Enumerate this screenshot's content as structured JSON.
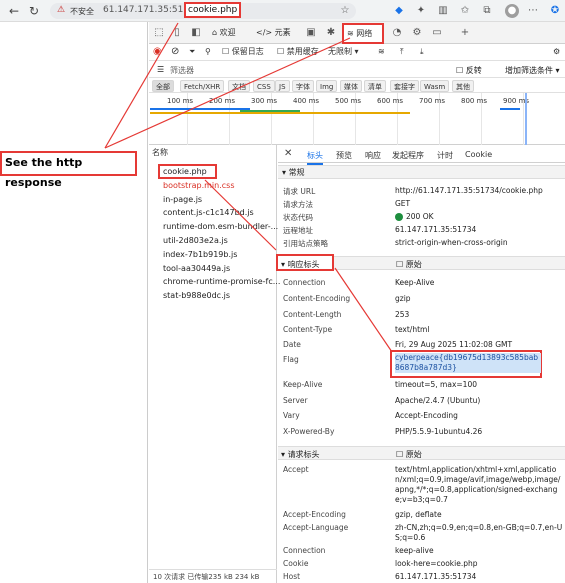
{
  "browser": {
    "security_label": "不安全",
    "url_host": "61.147.171.35:51734/",
    "url_path": "cookie.php"
  },
  "annotation": {
    "text": "See the http response"
  },
  "devtools": {
    "tabs": [
      "欢迎",
      "元素",
      "网络"
    ],
    "network_tab": "网络",
    "toolbar": {
      "preserve_log": "保留日志",
      "disable_cache": "禁用缓存",
      "throttle": "无限制"
    },
    "filter": {
      "placeholder": "筛选器",
      "invert": "反转",
      "more": "增加筛选条件"
    },
    "types": [
      "全部",
      "Fetch/XHR",
      "文档",
      "CSS",
      "JS",
      "字体",
      "Img",
      "媒体",
      "清单",
      "套接字",
      "Wasm",
      "其他"
    ],
    "timeline_ticks": [
      "100 ms",
      "200 ms",
      "300 ms",
      "400 ms",
      "500 ms",
      "600 ms",
      "700 ms",
      "800 ms",
      "900 ms"
    ],
    "list_header": "名称",
    "requests": [
      {
        "name": "cookie.php",
        "color": "#222"
      },
      {
        "name": "bootstrap.min.css",
        "color": "#d93025"
      },
      {
        "name": "in-page.js",
        "color": "#222"
      },
      {
        "name": "content.js-c1c147bd.js",
        "color": "#222"
      },
      {
        "name": "runtime-dom.esm-bundler-...",
        "color": "#222"
      },
      {
        "name": "util-2d803e2a.js",
        "color": "#222"
      },
      {
        "name": "index-7b1b919b.js",
        "color": "#222"
      },
      {
        "name": "tool-aa30449a.js",
        "color": "#222"
      },
      {
        "name": "chrome-runtime-promise-fc...",
        "color": "#222"
      },
      {
        "name": "stat-b988e0dc.js",
        "color": "#222"
      }
    ],
    "footer": "10 次请求  已传输235 kB  234 kB",
    "detail_tabs": [
      "标头",
      "预览",
      "响应",
      "发起程序",
      "计时",
      "Cookie"
    ],
    "general": {
      "title": "常规",
      "rows": [
        {
          "k": "请求 URL",
          "v": "http://61.147.171.35:51734/cookie.php"
        },
        {
          "k": "请求方法",
          "v": "GET"
        },
        {
          "k": "状态代码",
          "v": "200 OK"
        },
        {
          "k": "远程地址",
          "v": "61.147.171.35:51734"
        },
        {
          "k": "引用站点策略",
          "v": "strict-origin-when-cross-origin"
        }
      ]
    },
    "response_headers": {
      "title": "响应标头",
      "raw": "原始",
      "rows": [
        {
          "k": "Connection",
          "v": "Keep-Alive"
        },
        {
          "k": "Content-Encoding",
          "v": "gzip"
        },
        {
          "k": "Content-Length",
          "v": "253"
        },
        {
          "k": "Content-Type",
          "v": "text/html"
        },
        {
          "k": "Date",
          "v": "Fri, 29 Aug 2025 11:02:08 GMT"
        },
        {
          "k": "Flag",
          "v": "cyberpeace{db19675d13893c585bab8687b8a787d3}"
        },
        {
          "k": "Keep-Alive",
          "v": "timeout=5, max=100"
        },
        {
          "k": "Server",
          "v": "Apache/2.4.7 (Ubuntu)"
        },
        {
          "k": "Vary",
          "v": "Accept-Encoding"
        },
        {
          "k": "X-Powered-By",
          "v": "PHP/5.5.9-1ubuntu4.26"
        }
      ]
    },
    "request_headers": {
      "title": "请求标头",
      "raw": "原始",
      "rows": [
        {
          "k": "Accept",
          "v": "text/html,application/xhtml+xml,application/xml;q=0.9,image/avif,image/webp,image/apng,*/*;q=0.8,application/signed-exchange;v=b3;q=0.7"
        },
        {
          "k": "Accept-Encoding",
          "v": "gzip, deflate"
        },
        {
          "k": "Accept-Language",
          "v": "zh-CN,zh;q=0.9,en;q=0.8,en-GB;q=0.7,en-US;q=0.6"
        },
        {
          "k": "Connection",
          "v": "keep-alive"
        },
        {
          "k": "Cookie",
          "v": "look-here=cookie.php"
        },
        {
          "k": "Host",
          "v": "61.147.171.35:51734"
        }
      ]
    }
  },
  "colors": {
    "annotation": "#e53935",
    "status_ok": "#1e8e3e",
    "selected_flag_bg": "#cfe3f8"
  }
}
